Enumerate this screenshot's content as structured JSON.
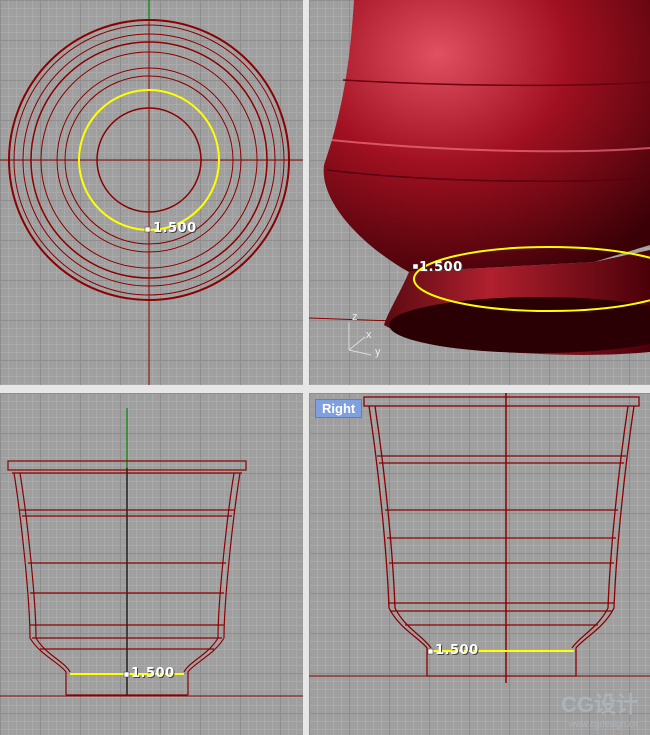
{
  "viewports": {
    "top": {
      "dim_label": "1.500"
    },
    "perspective": {
      "dim_label": "1.500",
      "axis_labels": [
        "z",
        "x",
        "y"
      ]
    },
    "front": {
      "dim_label": "1.500"
    },
    "right": {
      "title": "Right",
      "dim_label": "1.500"
    }
  },
  "watermark": {
    "text": "CG设计",
    "url": "www.cgdesign.cn"
  },
  "colors": {
    "curve": "#8b0000",
    "highlight": "#ffff00",
    "grid": "#9f9f9f",
    "active_title": "#7f9fe0"
  }
}
